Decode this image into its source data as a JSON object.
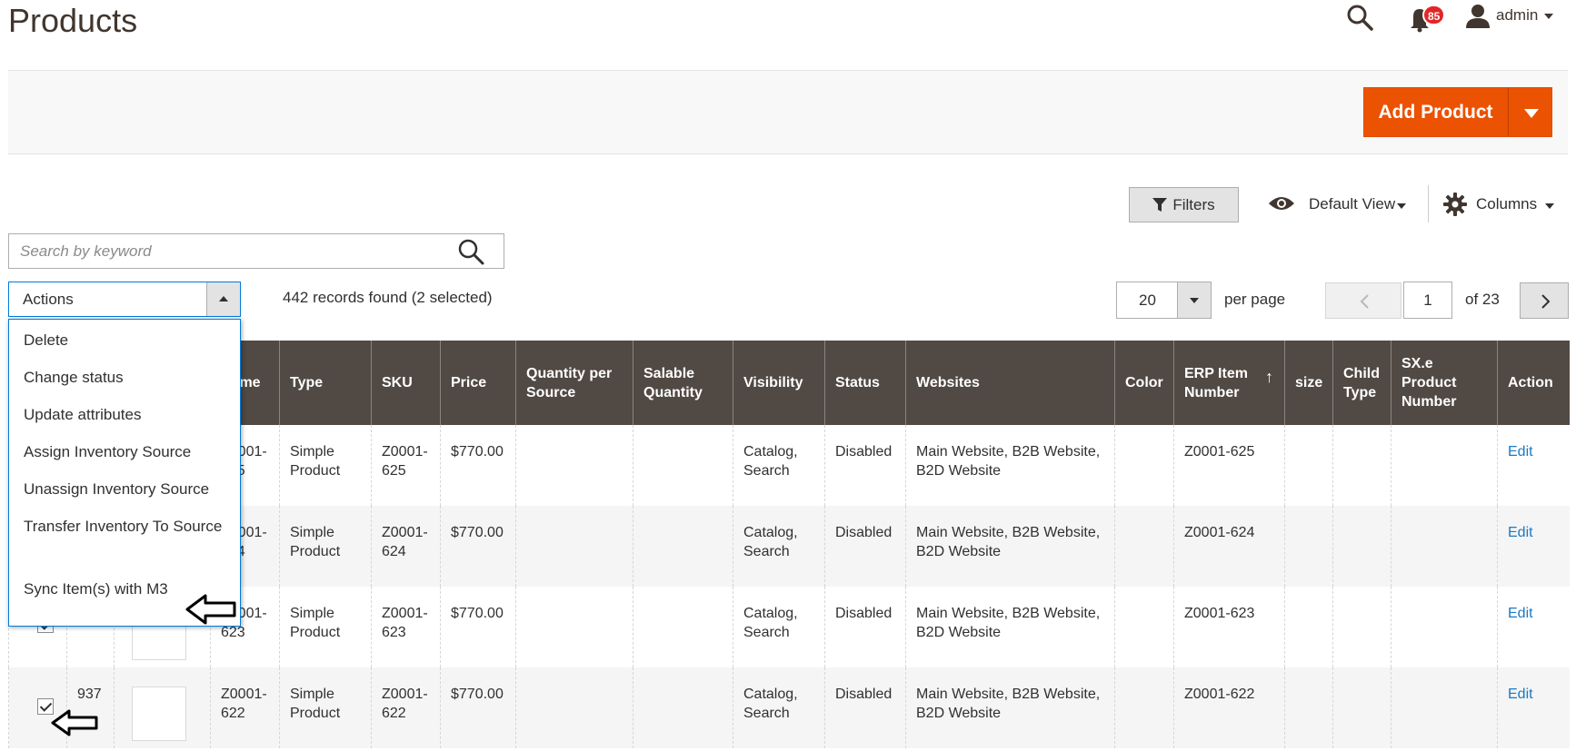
{
  "page": {
    "title": "Products"
  },
  "header": {
    "notifications_count": "85",
    "user_name": "admin"
  },
  "action_bar": {
    "add_button_label": "Add Product"
  },
  "toolbar": {
    "filters_label": "Filters",
    "view_label": "Default View",
    "columns_label": "Columns"
  },
  "search": {
    "placeholder": "Search by keyword"
  },
  "mass_actions": {
    "label": "Actions",
    "records_text": "442 records found (2 selected)",
    "items": [
      {
        "label": "Delete"
      },
      {
        "label": "Change status"
      },
      {
        "label": "Update attributes"
      },
      {
        "label": "Assign Inventory Source"
      },
      {
        "label": "Unassign Inventory Source"
      },
      {
        "label": "Transfer Inventory To Source"
      },
      {
        "label": "Sync Item(s) with M3"
      }
    ]
  },
  "pagination": {
    "per_page": "20",
    "per_page_label": "per page",
    "current_page": "1",
    "of_text": "of 23"
  },
  "grid": {
    "columns": [
      "",
      "",
      "",
      "Name",
      "Type",
      "SKU",
      "Price",
      "Quantity per Source",
      "Salable Quantity",
      "Visibility",
      "Status",
      "Websites",
      "Color",
      "ERP Item Number",
      "size",
      "Child Type",
      "SX.e Product Number",
      "Action"
    ],
    "sort_arrow": "↑",
    "rows": [
      {
        "id": "",
        "name": "Z0001-625",
        "type": "Simple Product",
        "sku": "Z0001-625",
        "price": "$770.00",
        "visibility": "Catalog, Search",
        "status": "Disabled",
        "websites": "Main Website, B2B Website, B2D Website",
        "erp": "Z0001-625",
        "action": "Edit"
      },
      {
        "id": "",
        "name": "Z0001-624",
        "type": "Simple Product",
        "sku": "Z0001-624",
        "price": "$770.00",
        "visibility": "Catalog, Search",
        "status": "Disabled",
        "websites": "Main Website, B2B Website, B2D Website",
        "erp": "Z0001-624",
        "action": "Edit"
      },
      {
        "id": "",
        "name": "Z0001-623",
        "type": "Simple Product",
        "sku": "Z0001-623",
        "price": "$770.00",
        "visibility": "Catalog, Search",
        "status": "Disabled",
        "websites": "Main Website, B2B Website, B2D Website",
        "erp": "Z0001-623",
        "action": "Edit"
      },
      {
        "id": "937",
        "name": "Z0001-622",
        "type": "Simple Product",
        "sku": "Z0001-622",
        "price": "$770.00",
        "visibility": "Catalog, Search",
        "status": "Disabled",
        "websites": "Main Website, B2B Website, B2D Website",
        "erp": "Z0001-622",
        "action": "Edit"
      }
    ]
  },
  "colors": {
    "accent": "#eb5202",
    "header_bg": "#514943",
    "link": "#1979c3",
    "focus": "#007bdb"
  }
}
